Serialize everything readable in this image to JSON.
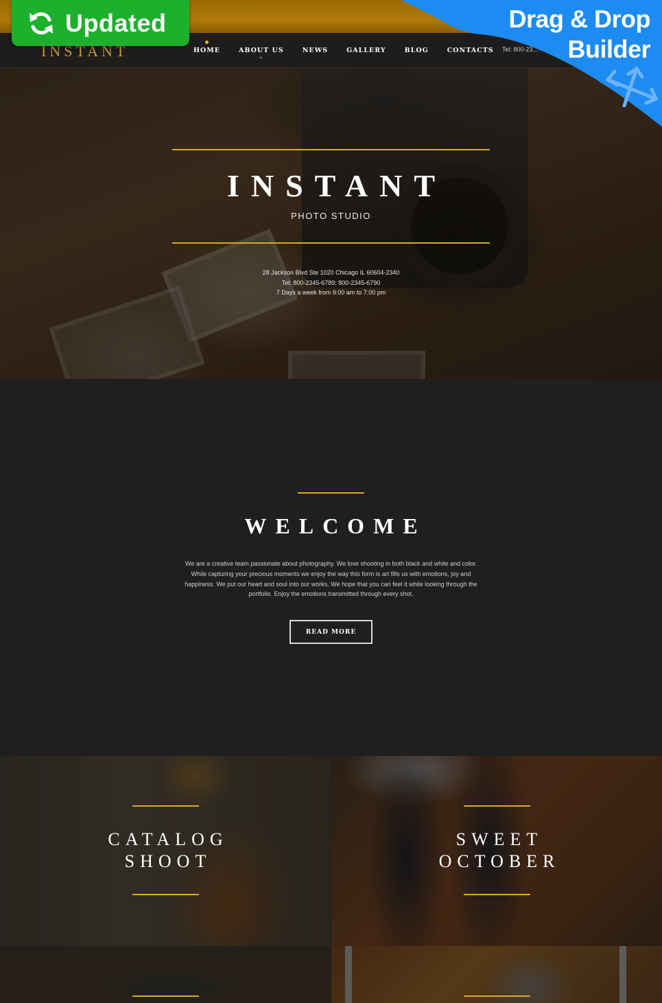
{
  "promo": {
    "updated_label": "Updated",
    "dd_line1": "Drag & Drop",
    "dd_line2": "Builder",
    "colors": {
      "updated_green": "#1db02c",
      "builder_blue": "#1c8cf2"
    }
  },
  "header": {
    "logo": "INSTANT",
    "nav": [
      {
        "label": "HOME",
        "active": true
      },
      {
        "label": "ABOUT US",
        "has_dropdown": true
      },
      {
        "label": "NEWS"
      },
      {
        "label": "GALLERY"
      },
      {
        "label": "BLOG"
      },
      {
        "label": "CONTACTS"
      }
    ],
    "tel": "Tel: 800-23..."
  },
  "hero": {
    "title": "INSTANT",
    "subtitle": "PHOTO STUDIO",
    "address": "28 Jackson Blvd Ste 1020 Chicago IL 60604-2340",
    "phones": "Tel: 800-2345-6789; 800-2345-6790",
    "hours": "7 Days a week from 9:00 am to 7:00 pm"
  },
  "welcome": {
    "title": "WELCOME",
    "text": "We are a creative team passionate about photography. We love shooting in both black and white and color. While capturing your precious moments we enjoy the way this form is art fills us with emotions, joy and happiness. We put our heart and soul into our works. We hope that you can feel it while looking through the portfolio. Enjoy the emotions transmitted through every shot.",
    "button": "READ MORE"
  },
  "gallery": [
    {
      "line1": "CATALOG",
      "line2": "SHOOT"
    },
    {
      "line1": "SWEET",
      "line2": "OCTOBER"
    },
    {
      "line1": "",
      "line2": ""
    },
    {
      "line1": "",
      "line2": ""
    }
  ],
  "colors": {
    "accent_gold": "#e0a826",
    "background": "#1f1f1f"
  }
}
